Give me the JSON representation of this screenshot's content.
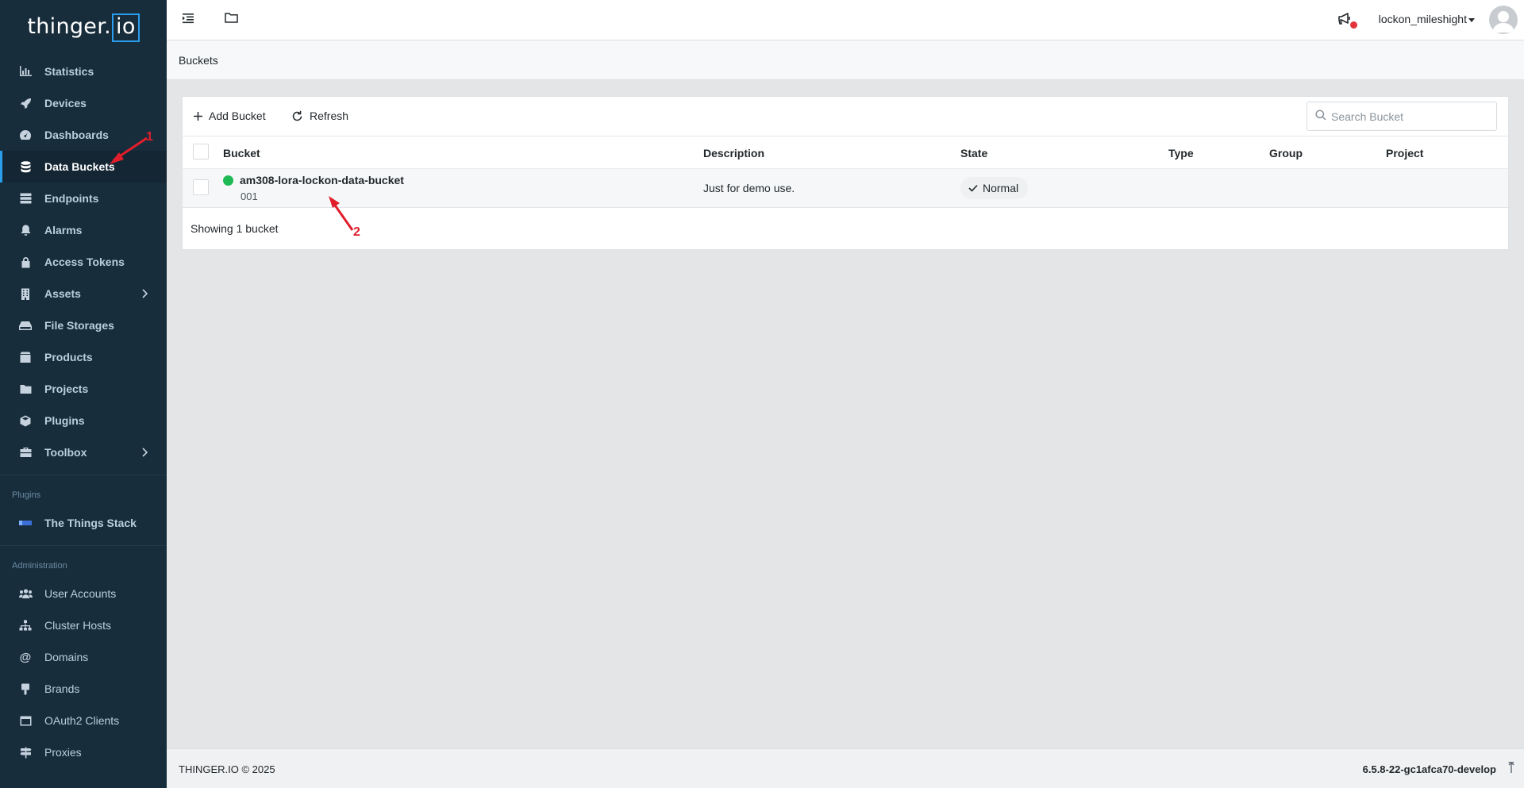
{
  "brand": {
    "logo_text": "thinger.",
    "logo_box": "io"
  },
  "sidebar": {
    "items": [
      {
        "label": "Statistics",
        "icon": "chart-icon"
      },
      {
        "label": "Devices",
        "icon": "rocket-icon"
      },
      {
        "label": "Dashboards",
        "icon": "gauge-icon"
      },
      {
        "label": "Data Buckets",
        "icon": "database-icon",
        "active": true
      },
      {
        "label": "Endpoints",
        "icon": "server-icon"
      },
      {
        "label": "Alarms",
        "icon": "bell-icon"
      },
      {
        "label": "Access Tokens",
        "icon": "lock-icon"
      },
      {
        "label": "Assets",
        "icon": "building-icon",
        "expandable": true
      },
      {
        "label": "File Storages",
        "icon": "storage-icon"
      },
      {
        "label": "Products",
        "icon": "box-icon"
      },
      {
        "label": "Projects",
        "icon": "folder-icon"
      },
      {
        "label": "Plugins",
        "icon": "cube-icon"
      },
      {
        "label": "Toolbox",
        "icon": "toolbox-icon",
        "expandable": true
      }
    ],
    "plugins_title": "Plugins",
    "plugins": [
      {
        "label": "The Things Stack",
        "icon": "ttn-icon"
      }
    ],
    "admin_title": "Administration",
    "admin": [
      {
        "label": "User Accounts",
        "icon": "users-icon"
      },
      {
        "label": "Cluster Hosts",
        "icon": "sitemap-icon"
      },
      {
        "label": "Domains",
        "icon": "at-icon"
      },
      {
        "label": "Brands",
        "icon": "brush-icon"
      },
      {
        "label": "OAuth2 Clients",
        "icon": "window-icon"
      },
      {
        "label": "Proxies",
        "icon": "signs-icon"
      }
    ]
  },
  "header": {
    "username": "lockon_mileshight"
  },
  "breadcrumb": {
    "title": "Buckets"
  },
  "toolbar": {
    "add_label": "Add Bucket",
    "refresh_label": "Refresh"
  },
  "search": {
    "placeholder": "Search Bucket"
  },
  "table": {
    "columns": [
      "Bucket",
      "Description",
      "State",
      "Type",
      "Group",
      "Project"
    ],
    "rows": [
      {
        "name": "am308-lora-lockon-data-bucket",
        "id": "001",
        "description": "Just for demo use.",
        "state": "Normal",
        "status_color": "#1db954"
      }
    ],
    "footer": "Showing 1 bucket"
  },
  "annotations": [
    "1",
    "2"
  ],
  "footer": {
    "copyright": "THINGER.IO © 2025",
    "version": "6.5.8-22-gc1afca70-develop"
  },
  "colors": {
    "sidebar_bg": "#182d3c",
    "accent": "#2a9ded",
    "annotation": "#e01e2b",
    "active_dot": "#1db954"
  }
}
